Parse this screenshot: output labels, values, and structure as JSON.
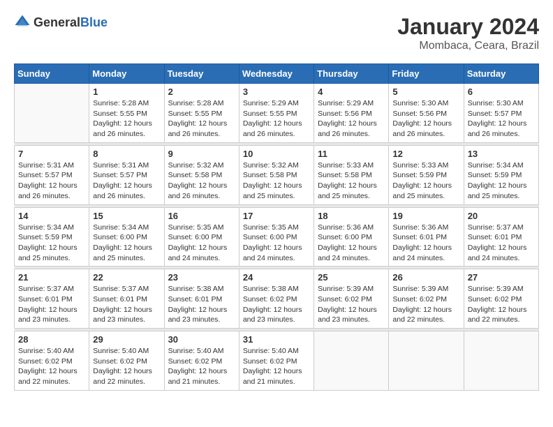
{
  "header": {
    "logo_general": "General",
    "logo_blue": "Blue",
    "title": "January 2024",
    "subtitle": "Mombaca, Ceara, Brazil"
  },
  "calendar": {
    "days_of_week": [
      "Sunday",
      "Monday",
      "Tuesday",
      "Wednesday",
      "Thursday",
      "Friday",
      "Saturday"
    ],
    "weeks": [
      [
        {
          "day": "",
          "info": ""
        },
        {
          "day": "1",
          "info": "Sunrise: 5:28 AM\nSunset: 5:55 PM\nDaylight: 12 hours\nand 26 minutes."
        },
        {
          "day": "2",
          "info": "Sunrise: 5:28 AM\nSunset: 5:55 PM\nDaylight: 12 hours\nand 26 minutes."
        },
        {
          "day": "3",
          "info": "Sunrise: 5:29 AM\nSunset: 5:55 PM\nDaylight: 12 hours\nand 26 minutes."
        },
        {
          "day": "4",
          "info": "Sunrise: 5:29 AM\nSunset: 5:56 PM\nDaylight: 12 hours\nand 26 minutes."
        },
        {
          "day": "5",
          "info": "Sunrise: 5:30 AM\nSunset: 5:56 PM\nDaylight: 12 hours\nand 26 minutes."
        },
        {
          "day": "6",
          "info": "Sunrise: 5:30 AM\nSunset: 5:57 PM\nDaylight: 12 hours\nand 26 minutes."
        }
      ],
      [
        {
          "day": "7",
          "info": "Sunrise: 5:31 AM\nSunset: 5:57 PM\nDaylight: 12 hours\nand 26 minutes."
        },
        {
          "day": "8",
          "info": "Sunrise: 5:31 AM\nSunset: 5:57 PM\nDaylight: 12 hours\nand 26 minutes."
        },
        {
          "day": "9",
          "info": "Sunrise: 5:32 AM\nSunset: 5:58 PM\nDaylight: 12 hours\nand 26 minutes."
        },
        {
          "day": "10",
          "info": "Sunrise: 5:32 AM\nSunset: 5:58 PM\nDaylight: 12 hours\nand 25 minutes."
        },
        {
          "day": "11",
          "info": "Sunrise: 5:33 AM\nSunset: 5:58 PM\nDaylight: 12 hours\nand 25 minutes."
        },
        {
          "day": "12",
          "info": "Sunrise: 5:33 AM\nSunset: 5:59 PM\nDaylight: 12 hours\nand 25 minutes."
        },
        {
          "day": "13",
          "info": "Sunrise: 5:34 AM\nSunset: 5:59 PM\nDaylight: 12 hours\nand 25 minutes."
        }
      ],
      [
        {
          "day": "14",
          "info": "Sunrise: 5:34 AM\nSunset: 5:59 PM\nDaylight: 12 hours\nand 25 minutes."
        },
        {
          "day": "15",
          "info": "Sunrise: 5:34 AM\nSunset: 6:00 PM\nDaylight: 12 hours\nand 25 minutes."
        },
        {
          "day": "16",
          "info": "Sunrise: 5:35 AM\nSunset: 6:00 PM\nDaylight: 12 hours\nand 24 minutes."
        },
        {
          "day": "17",
          "info": "Sunrise: 5:35 AM\nSunset: 6:00 PM\nDaylight: 12 hours\nand 24 minutes."
        },
        {
          "day": "18",
          "info": "Sunrise: 5:36 AM\nSunset: 6:00 PM\nDaylight: 12 hours\nand 24 minutes."
        },
        {
          "day": "19",
          "info": "Sunrise: 5:36 AM\nSunset: 6:01 PM\nDaylight: 12 hours\nand 24 minutes."
        },
        {
          "day": "20",
          "info": "Sunrise: 5:37 AM\nSunset: 6:01 PM\nDaylight: 12 hours\nand 24 minutes."
        }
      ],
      [
        {
          "day": "21",
          "info": "Sunrise: 5:37 AM\nSunset: 6:01 PM\nDaylight: 12 hours\nand 23 minutes."
        },
        {
          "day": "22",
          "info": "Sunrise: 5:37 AM\nSunset: 6:01 PM\nDaylight: 12 hours\nand 23 minutes."
        },
        {
          "day": "23",
          "info": "Sunrise: 5:38 AM\nSunset: 6:01 PM\nDaylight: 12 hours\nand 23 minutes."
        },
        {
          "day": "24",
          "info": "Sunrise: 5:38 AM\nSunset: 6:02 PM\nDaylight: 12 hours\nand 23 minutes."
        },
        {
          "day": "25",
          "info": "Sunrise: 5:39 AM\nSunset: 6:02 PM\nDaylight: 12 hours\nand 23 minutes."
        },
        {
          "day": "26",
          "info": "Sunrise: 5:39 AM\nSunset: 6:02 PM\nDaylight: 12 hours\nand 22 minutes."
        },
        {
          "day": "27",
          "info": "Sunrise: 5:39 AM\nSunset: 6:02 PM\nDaylight: 12 hours\nand 22 minutes."
        }
      ],
      [
        {
          "day": "28",
          "info": "Sunrise: 5:40 AM\nSunset: 6:02 PM\nDaylight: 12 hours\nand 22 minutes."
        },
        {
          "day": "29",
          "info": "Sunrise: 5:40 AM\nSunset: 6:02 PM\nDaylight: 12 hours\nand 22 minutes."
        },
        {
          "day": "30",
          "info": "Sunrise: 5:40 AM\nSunset: 6:02 PM\nDaylight: 12 hours\nand 21 minutes."
        },
        {
          "day": "31",
          "info": "Sunrise: 5:40 AM\nSunset: 6:02 PM\nDaylight: 12 hours\nand 21 minutes."
        },
        {
          "day": "",
          "info": ""
        },
        {
          "day": "",
          "info": ""
        },
        {
          "day": "",
          "info": ""
        }
      ]
    ]
  }
}
